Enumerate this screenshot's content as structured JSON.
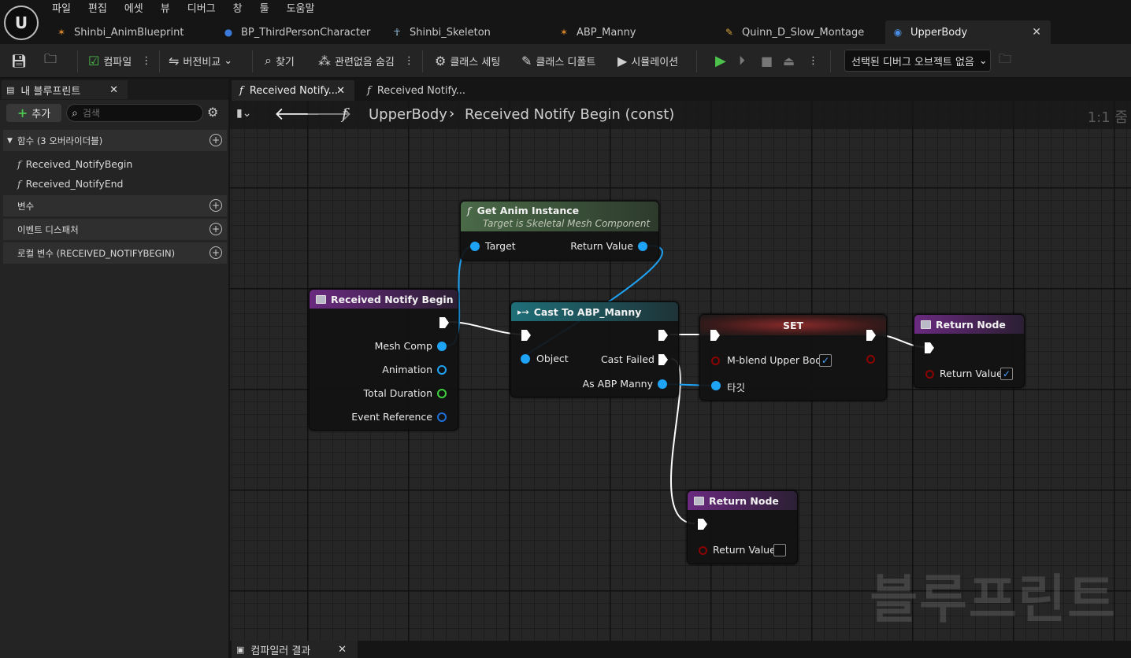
{
  "menu": [
    "파일",
    "편집",
    "에셋",
    "뷰",
    "디버그",
    "창",
    "툴",
    "도움말"
  ],
  "doc_tabs": [
    {
      "label": "Shinbi_AnimBlueprint",
      "icon": "anim-blueprint-icon"
    },
    {
      "label": "BP_ThirdPersonCharacter",
      "icon": "character-icon"
    },
    {
      "label": "Shinbi_Skeleton",
      "icon": "skeleton-icon"
    },
    {
      "label": "ABP_Manny",
      "icon": "anim-blueprint-icon"
    },
    {
      "label": "Quinn_D_Slow_Montage",
      "icon": "montage-icon"
    },
    {
      "label": "UpperBody",
      "icon": "blueprint-icon",
      "active": true
    }
  ],
  "toolbar": {
    "compile": "컴파일",
    "diff": "버전비교",
    "find": "찾기",
    "hide_unrelated": "관련없음 숨김",
    "class_settings": "클래스 세팅",
    "class_defaults": "클래스 디폴트",
    "simulation": "시뮬레이션",
    "debug_object": "선택된 디버그 오브젝트 없음"
  },
  "my_blueprint": {
    "tab": "내 블루프린트",
    "add": "추가",
    "search_placeholder": "검색",
    "sections": {
      "functions": "함수 (3 오버라이더블)",
      "variables": "변수",
      "dispatchers": "이벤트 디스패처",
      "locals": "로컬 변수 (RECEIVED_NOTIFYBEGIN)"
    },
    "functions": [
      "Received_NotifyBegin",
      "Received_NotifyEnd"
    ]
  },
  "graph": {
    "tabs": [
      "Received Notify...",
      "Received Notify..."
    ],
    "breadcrumb_root": "UpperBody",
    "breadcrumb_current": "Received Notify Begin (const)",
    "zoom": "1:1 줌",
    "watermark": "블루프린트"
  },
  "nodes": {
    "get_anim": {
      "title": "Get Anim Instance",
      "subtitle": "Target is Skeletal Mesh Component",
      "in": "Target",
      "out": "Return Value"
    },
    "entry": {
      "title": "Received Notify Begin",
      "pins": [
        "Mesh Comp",
        "Animation",
        "Total Duration",
        "Event Reference"
      ]
    },
    "cast": {
      "title": "Cast To ABP_Manny",
      "object": "Object",
      "cast_failed": "Cast Failed",
      "as": "As ABP Manny"
    },
    "set": {
      "title": "SET",
      "var": "M-blend Upper Body",
      "target": "타깃"
    },
    "return1": {
      "title": "Return Node",
      "value": "Return Value"
    },
    "return2": {
      "title": "Return Node",
      "value": "Return Value"
    }
  },
  "bottom": {
    "compiler_tab": "컴파일러 결과"
  },
  "colors": {
    "object_pin": "#1ea3f5",
    "bool_pin": "#8c0303",
    "exec_pin": "#ffffff",
    "float_pin": "#3ed03e",
    "accent": "#2f6fd6"
  }
}
